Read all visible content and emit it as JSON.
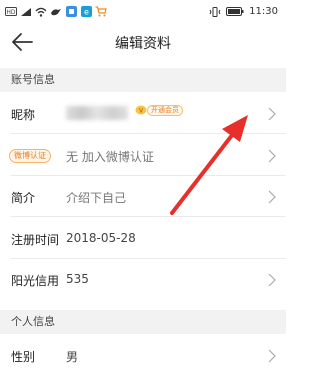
{
  "statusbar": {
    "left_icons": [
      "hd-icon",
      "signal-icon",
      "wifi-icon",
      "bird-icon",
      "app-icon-1",
      "app-icon-2",
      "cart-icon"
    ],
    "right_icons": [
      "vibrate-icon",
      "battery-icon"
    ],
    "time": "11:30"
  },
  "header": {
    "title": "编辑资料"
  },
  "sections": {
    "account": {
      "title": "账号信息"
    },
    "personal": {
      "title": "个人信息"
    }
  },
  "rows": {
    "nickname": {
      "label": "昵称",
      "vip_badge": "开通会员"
    },
    "weibo": {
      "badge": "微博认证",
      "value": "无 加入微博认证"
    },
    "bio": {
      "label": "简介",
      "value": "介绍下自己"
    },
    "register": {
      "label": "注册时间",
      "value": "2018-05-28"
    },
    "credit": {
      "label": "阳光信用",
      "value": "535"
    },
    "gender": {
      "label": "性别",
      "value": "男"
    }
  },
  "colors": {
    "accent_orange": "#e8802a",
    "annotation_red": "#e8302a",
    "section_bg": "#f2f2f2"
  }
}
